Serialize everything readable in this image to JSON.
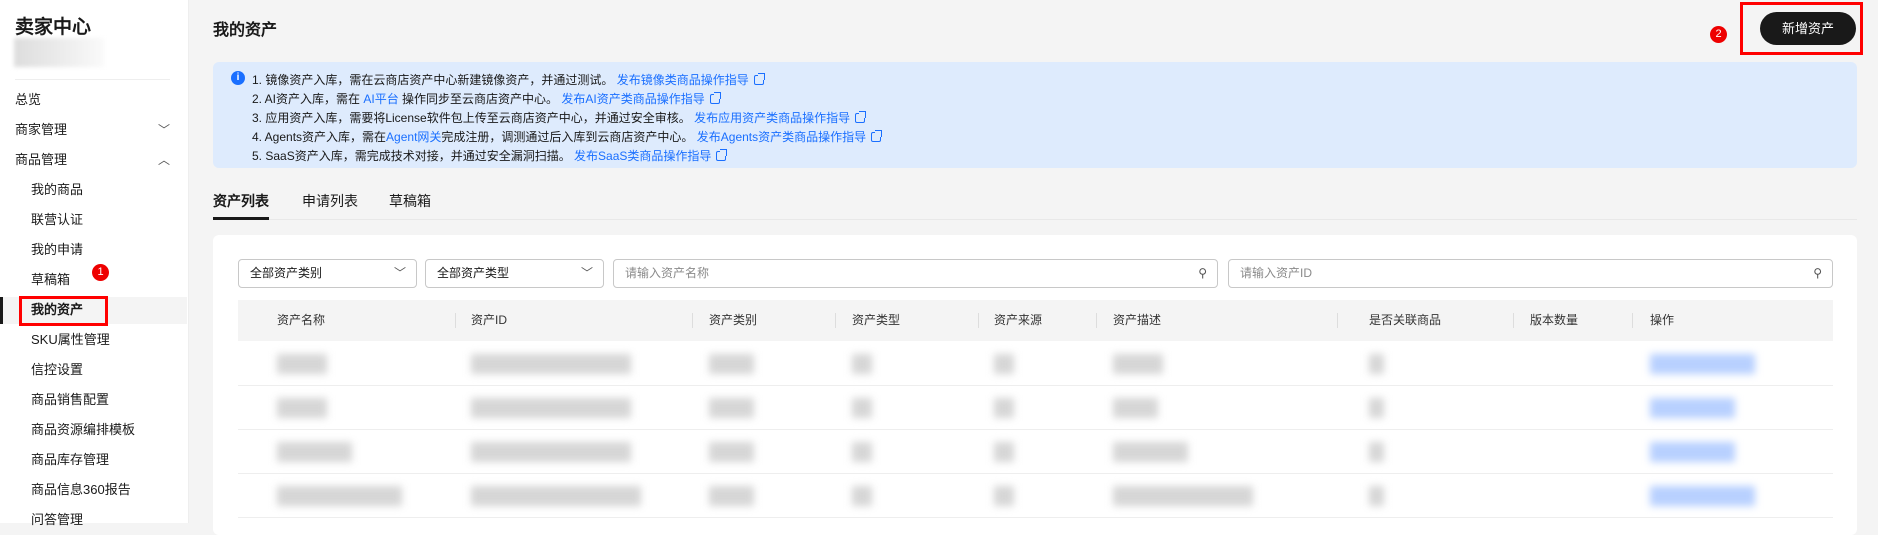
{
  "sidebar": {
    "title": "卖家中心",
    "items": [
      {
        "label": "总览"
      },
      {
        "label": "商家管理",
        "chevron": "down"
      },
      {
        "label": "商品管理",
        "chevron": "up"
      },
      {
        "label": "我的商品"
      },
      {
        "label": "联营认证"
      },
      {
        "label": "我的申请"
      },
      {
        "label": "草稿箱"
      },
      {
        "label": "我的资产",
        "active": true
      },
      {
        "label": "SKU属性管理"
      },
      {
        "label": "信控设置"
      },
      {
        "label": "商品销售配置"
      },
      {
        "label": "商品资源编排模板"
      },
      {
        "label": "商品库存管理"
      },
      {
        "label": "商品信息360报告"
      },
      {
        "label": "问答管理"
      }
    ]
  },
  "annotations": {
    "badge1": "1",
    "badge2": "2"
  },
  "header": {
    "title": "我的资产",
    "add_button": "新增资产"
  },
  "info": {
    "l1": "1. 镜像资产入库，需在云商店资产中心新建镜像资产，并通过测试。",
    "l1_link": "发布镜像类商品操作指导",
    "l2a": "2. AI资产入库，需在 ",
    "l2_inline": "AI平台",
    "l2b": " 操作同步至云商店资产中心。",
    "l2_link": "发布AI资产类商品操作指导",
    "l3": "3. 应用资产入库，需要将License软件包上传至云商店资产中心，并通过安全审核。",
    "l3_link": "发布应用资产类商品操作指导",
    "l4a": "4. Agents资产入库，需在",
    "l4_inline": "Agent网关",
    "l4b": "完成注册，调测通过后入库到云商店资产中心。",
    "l4_link": "发布Agents资产类商品操作指导",
    "l5": "5. SaaS资产入库，需完成技术对接，并通过安全漏洞扫描。",
    "l5_link": "发布SaaS类商品操作指导"
  },
  "tabs": [
    "资产列表",
    "申请列表",
    "草稿箱"
  ],
  "filters": {
    "category": "全部资产类别",
    "type": "全部资产类型",
    "name_placeholder": "请输入资产名称",
    "id_placeholder": "请输入资产ID"
  },
  "table": {
    "columns": [
      "资产名称",
      "资产ID",
      "资产类别",
      "资产类型",
      "资产来源",
      "资产描述",
      "是否关联商品",
      "版本数量",
      "操作"
    ]
  },
  "colors": {
    "accent": "#1a6fff",
    "primary_button": "#191919",
    "annotation": "#ff0000"
  }
}
